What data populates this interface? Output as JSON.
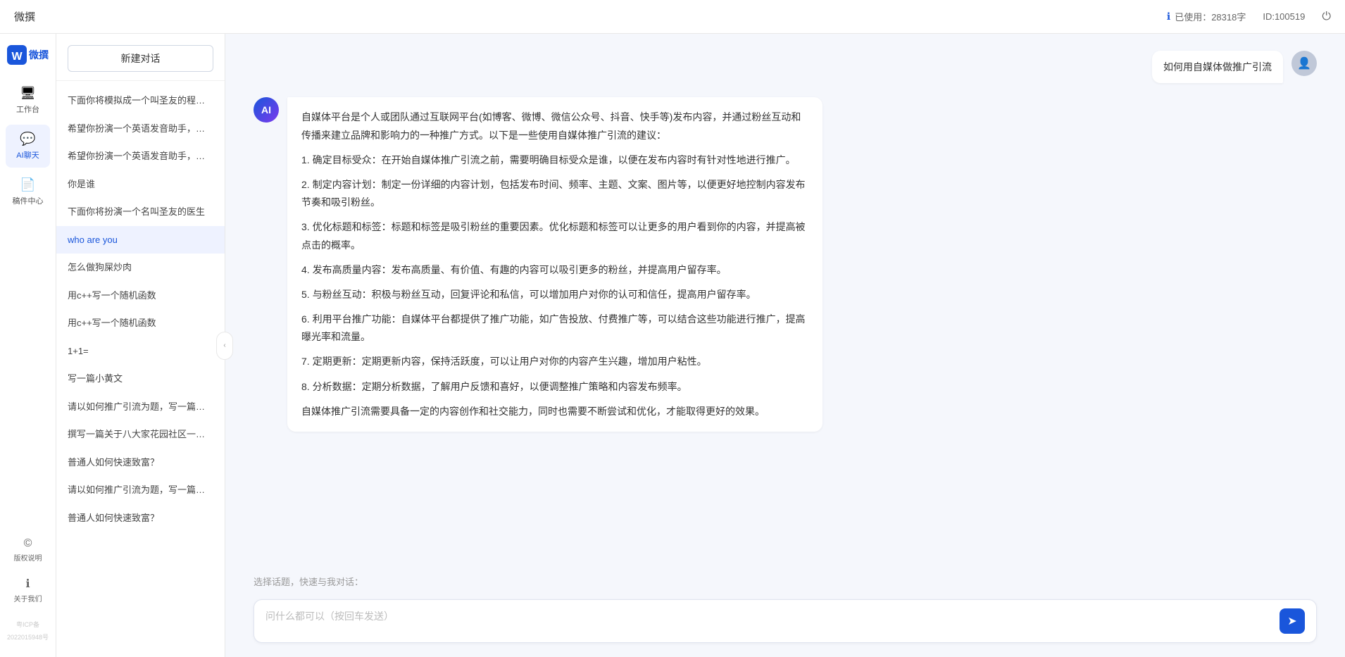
{
  "topbar": {
    "title": "微撰",
    "usage_label": "已使用：28318字",
    "id_label": "ID:100519",
    "info_icon": "ℹ",
    "power_icon": "⏻"
  },
  "sidebar_nav": {
    "brand": "W 微撰",
    "items": [
      {
        "id": "workbench",
        "icon": "🖥",
        "label": "工作台"
      },
      {
        "id": "ai-chat",
        "icon": "💬",
        "label": "AI聊天"
      },
      {
        "id": "drafts",
        "icon": "📄",
        "label": "稿件中心"
      }
    ],
    "bottom_items": [
      {
        "id": "copyright",
        "icon": "©",
        "label": "版权说明"
      },
      {
        "id": "about",
        "icon": "ℹ",
        "label": "关于我们"
      }
    ],
    "icp": "粤ICP备2022015948号"
  },
  "history": {
    "new_chat_label": "新建对话",
    "items": [
      {
        "id": 1,
        "text": "下面你将模拟成一个叫圣友的程序员，我说...",
        "active": false
      },
      {
        "id": 2,
        "text": "希望你扮演一个英语发音助手，我提供给你...",
        "active": false
      },
      {
        "id": 3,
        "text": "希望你扮演一个英语发音助手，我提供给你...",
        "active": false
      },
      {
        "id": 4,
        "text": "你是谁",
        "active": false
      },
      {
        "id": 5,
        "text": "下面你将扮演一个名叫圣友的医生",
        "active": false
      },
      {
        "id": 6,
        "text": "who are you",
        "active": true
      },
      {
        "id": 7,
        "text": "怎么做狗屎炒肉",
        "active": false
      },
      {
        "id": 8,
        "text": "用c++写一个随机函数",
        "active": false
      },
      {
        "id": 9,
        "text": "用c++写一个随机函数",
        "active": false
      },
      {
        "id": 10,
        "text": "1+1=",
        "active": false
      },
      {
        "id": 11,
        "text": "写一篇小黄文",
        "active": false
      },
      {
        "id": 12,
        "text": "请以如何推广引流为题，写一篇大纲",
        "active": false
      },
      {
        "id": 13,
        "text": "撰写一篇关于八大家花园社区一刻钟便民生...",
        "active": false
      },
      {
        "id": 14,
        "text": "普通人如何快速致富？",
        "active": false
      },
      {
        "id": 15,
        "text": "请以如何推广引流为题，写一篇大纲",
        "active": false
      },
      {
        "id": 16,
        "text": "普通人如何快速致富？",
        "active": false
      }
    ]
  },
  "chat": {
    "user_message": "如何用自媒体做推广引流",
    "ai_response": {
      "paragraphs": [
        "自媒体平台是个人或团队通过互联网平台(如博客、微博、微信公众号、抖音、快手等)发布内容，并通过粉丝互动和传播来建立品牌和影响力的一种推广方式。以下是一些使用自媒体推广引流的建议：",
        "1. 确定目标受众：在开始自媒体推广引流之前，需要明确目标受众是谁，以便在发布内容时有针对性地进行推广。",
        "2. 制定内容计划：制定一份详细的内容计划，包括发布时间、频率、主题、文案、图片等，以便更好地控制内容发布节奏和吸引粉丝。",
        "3. 优化标题和标签：标题和标签是吸引粉丝的重要因素。优化标题和标签可以让更多的用户看到你的内容，并提高被点击的概率。",
        "4. 发布高质量内容：发布高质量、有价值、有趣的内容可以吸引更多的粉丝，并提高用户留存率。",
        "5. 与粉丝互动：积极与粉丝互动，回复评论和私信，可以增加用户对你的认可和信任，提高用户留存率。",
        "6. 利用平台推广功能：自媒体平台都提供了推广功能，如广告投放、付费推广等，可以结合这些功能进行推广，提高曝光率和流量。",
        "7. 定期更新：定期更新内容，保持活跃度，可以让用户对你的内容产生兴趣，增加用户粘性。",
        "8. 分析数据：定期分析数据，了解用户反馈和喜好，以便调整推广策略和内容发布频率。",
        "自媒体推广引流需要具备一定的内容创作和社交能力，同时也需要不断尝试和优化，才能取得更好的效果。"
      ]
    },
    "quick_topics_label": "选择话题，快速与我对话：",
    "input_placeholder": "问什么都可以（按回车发送）"
  },
  "colors": {
    "primary": "#1a56db",
    "bg": "#f5f7fc"
  }
}
